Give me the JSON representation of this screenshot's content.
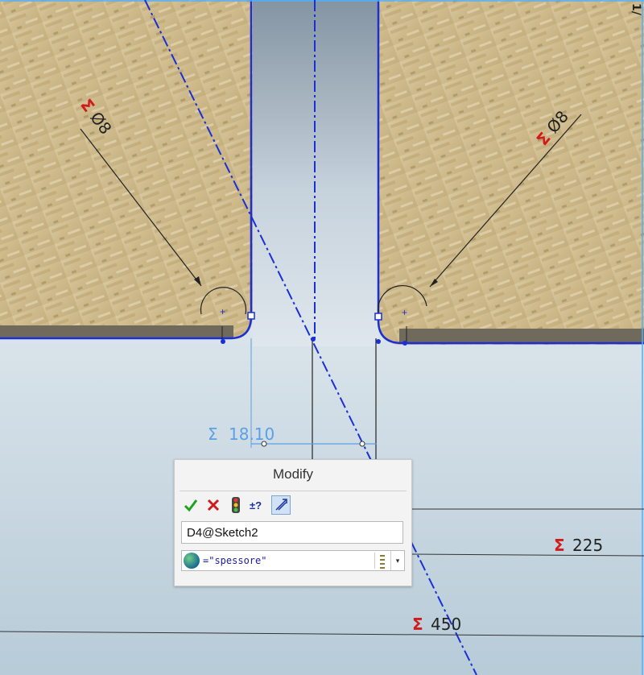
{
  "dialog": {
    "title": "Modify",
    "toolbar": {
      "ok_icon": "checkmark-icon",
      "cancel_icon": "x-icon",
      "rebuild_icon": "traffic-light-icon",
      "reverse_icon": "plus-minus-question-icon",
      "mark_icon": "dimension-mark-icon"
    },
    "dimension_name": "D4@Sketch2",
    "value": "=\"spessore\"",
    "dropdown_arrow": "▾"
  },
  "dimensions": {
    "left_diameter": "Ø8",
    "right_diameter": "Ø8",
    "sigma": "Σ",
    "width_value": "18.10",
    "dim_225": "225",
    "dim_450": "450",
    "corner_text": "1/"
  },
  "colors": {
    "sketch_blue": "#1a2fd6",
    "selected_dim": "#5aa0e6",
    "sigma_red": "#d11a1a"
  }
}
